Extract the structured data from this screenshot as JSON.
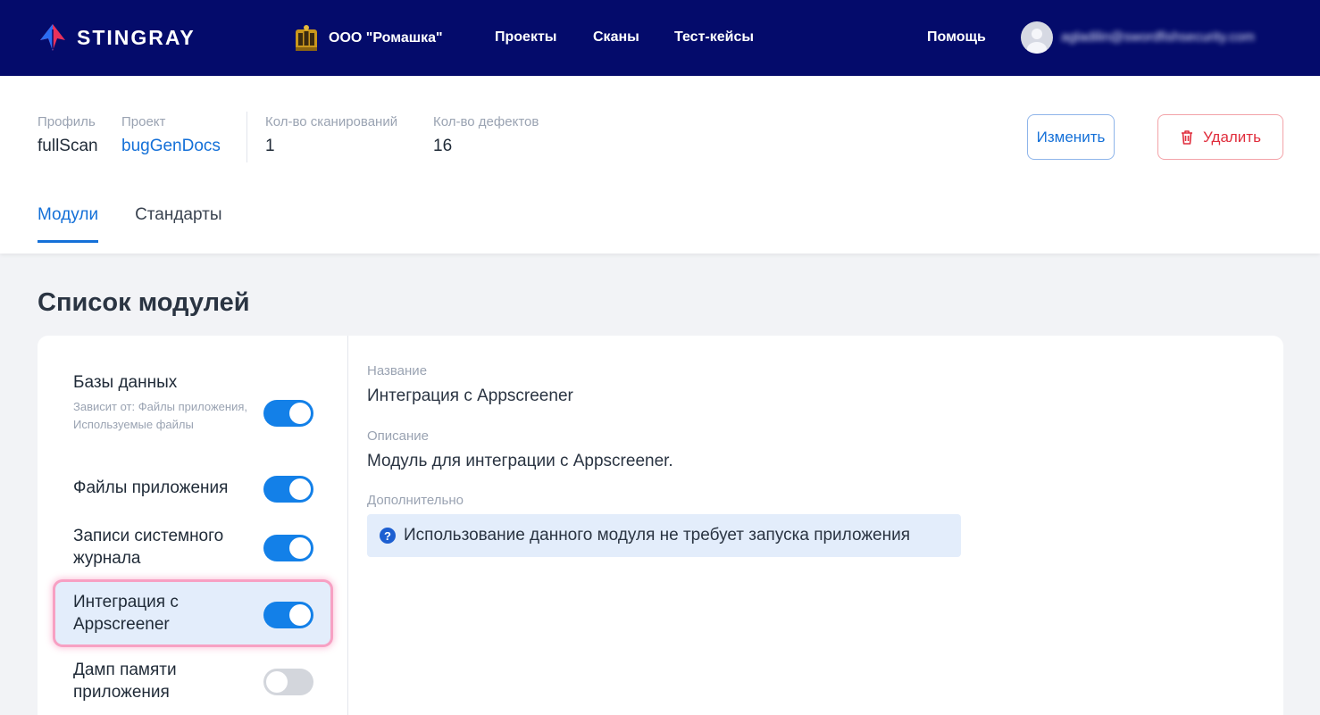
{
  "topbar": {
    "brand": "STINGRAY",
    "org": "ООО \"Ромашка\"",
    "nav": [
      "Проекты",
      "Сканы",
      "Тест-кейсы"
    ],
    "help": "Помощь",
    "user_email": "agladilin@swordfishsecurity.com"
  },
  "header": {
    "profile_label": "Профиль",
    "profile_value": "fullScan",
    "project_label": "Проект",
    "project_value": "bugGenDocs",
    "scans_label": "Кол-во сканирований",
    "scans_value": "1",
    "defects_label": "Кол-во дефектов",
    "defects_value": "16",
    "edit_label": "Изменить",
    "delete_label": "Удалить"
  },
  "tabs": [
    {
      "label": "Модули",
      "active": true
    },
    {
      "label": "Стандарты",
      "active": false
    }
  ],
  "section_title": "Список модулей",
  "modules": [
    {
      "name": "Базы данных",
      "dependency": "Зависит от:  Файлы приложения, Используемые файлы",
      "enabled": true
    },
    {
      "name": "Файлы приложения",
      "enabled": true
    },
    {
      "name": "Записи системного журнала",
      "enabled": true
    },
    {
      "name": "Интеграция с Appscreener",
      "enabled": true,
      "selected": true
    },
    {
      "name": "Дамп памяти приложения",
      "enabled": false
    }
  ],
  "details": {
    "name_label": "Название",
    "name_value": "Интеграция с Appscreener",
    "desc_label": "Описание",
    "desc_value": "Модуль для интеграции с Appscreener.",
    "extra_label": "Дополнительно",
    "extra_value": "Использование данного модуля не требует запуска приложения"
  },
  "colors": {
    "navbar": "#040b6b",
    "accent": "#1470d8",
    "toggle_on": "#1380e8",
    "danger": "#e02d3c",
    "highlight_outline": "#f7a0c3"
  }
}
